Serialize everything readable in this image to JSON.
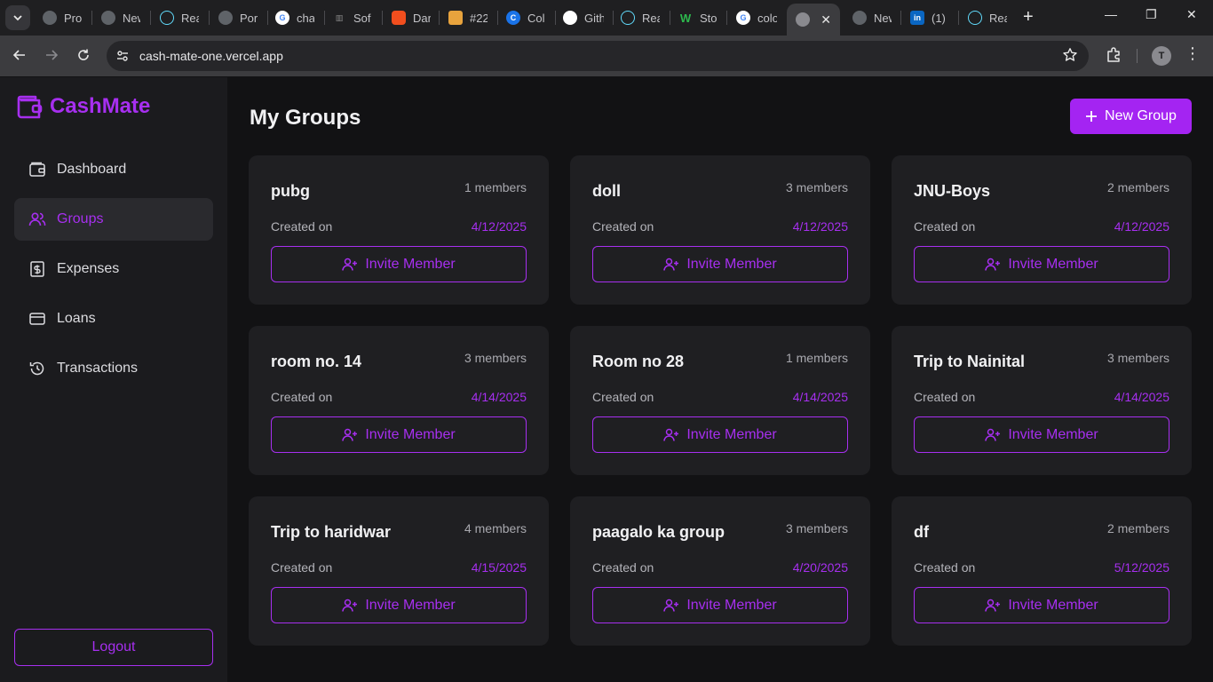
{
  "browser": {
    "tabs": [
      {
        "label": "Pro",
        "icon": "generic-globe-icon",
        "color": "#bdbdbd"
      },
      {
        "label": "New",
        "icon": "chrome-icon",
        "color": "#bdbdbd"
      },
      {
        "label": "Rea",
        "icon": "react-icon",
        "color": "#61dafb"
      },
      {
        "label": "Por",
        "icon": "generic-globe-icon",
        "color": "#bdbdbd"
      },
      {
        "label": "cha",
        "icon": "google-icon",
        "color": "#ffffff"
      },
      {
        "label": "Sof",
        "icon": "chart-icon",
        "color": "#777777"
      },
      {
        "label": "Dar",
        "icon": "figma-icon",
        "color": "#f24e1e"
      },
      {
        "label": "#22",
        "icon": "hex-icon",
        "color": "#e8a33d"
      },
      {
        "label": "Col",
        "icon": "c-icon",
        "color": "#1a73e8"
      },
      {
        "label": "Gith",
        "icon": "github-icon",
        "color": "#ffffff"
      },
      {
        "label": "Rea",
        "icon": "react-icon",
        "color": "#61dafb"
      },
      {
        "label": "Sto",
        "icon": "w-icon",
        "color": "#2db84d"
      },
      {
        "label": "colo",
        "icon": "google-icon",
        "color": "#ffffff"
      },
      {
        "label": "",
        "icon": "generic-globe-icon",
        "color": "#bdbdbd",
        "active": true
      },
      {
        "label": "New",
        "icon": "chrome-icon",
        "color": "#bdbdbd"
      },
      {
        "label": "(1)",
        "icon": "linkedin-icon",
        "color": "#0a66c2"
      },
      {
        "label": "Rea",
        "icon": "react-icon",
        "color": "#61dafb"
      }
    ],
    "url": "cash-mate-one.vercel.app",
    "profile_initial": "T"
  },
  "app": {
    "brand": "CashMate",
    "accent": "#a72ff0",
    "nav": [
      {
        "label": "Dashboard",
        "icon": "wallet-icon",
        "active": false
      },
      {
        "label": "Groups",
        "icon": "users-icon",
        "active": true
      },
      {
        "label": "Expenses",
        "icon": "dollar-receipt-icon",
        "active": false
      },
      {
        "label": "Loans",
        "icon": "credit-card-icon",
        "active": false
      },
      {
        "label": "Transactions",
        "icon": "history-icon",
        "active": false
      }
    ],
    "logout_label": "Logout"
  },
  "page": {
    "title": "My Groups",
    "new_group_label": "New Group",
    "created_on_label": "Created on",
    "invite_label": "Invite Member",
    "groups": [
      {
        "name": "pubg",
        "members": "1 members",
        "date": "4/12/2025"
      },
      {
        "name": "doll",
        "members": "3 members",
        "date": "4/12/2025"
      },
      {
        "name": "JNU-Boys",
        "members": "2 members",
        "date": "4/12/2025"
      },
      {
        "name": "room no. 14",
        "members": "3 members",
        "date": "4/14/2025"
      },
      {
        "name": "Room no 28",
        "members": "1 members",
        "date": "4/14/2025"
      },
      {
        "name": "Trip to Nainital",
        "members": "3 members",
        "date": "4/14/2025"
      },
      {
        "name": "Trip to haridwar",
        "members": "4 members",
        "date": "4/15/2025"
      },
      {
        "name": "paagalo ka group",
        "members": "3 members",
        "date": "4/20/2025"
      },
      {
        "name": "df",
        "members": "2 members",
        "date": "5/12/2025"
      }
    ]
  }
}
